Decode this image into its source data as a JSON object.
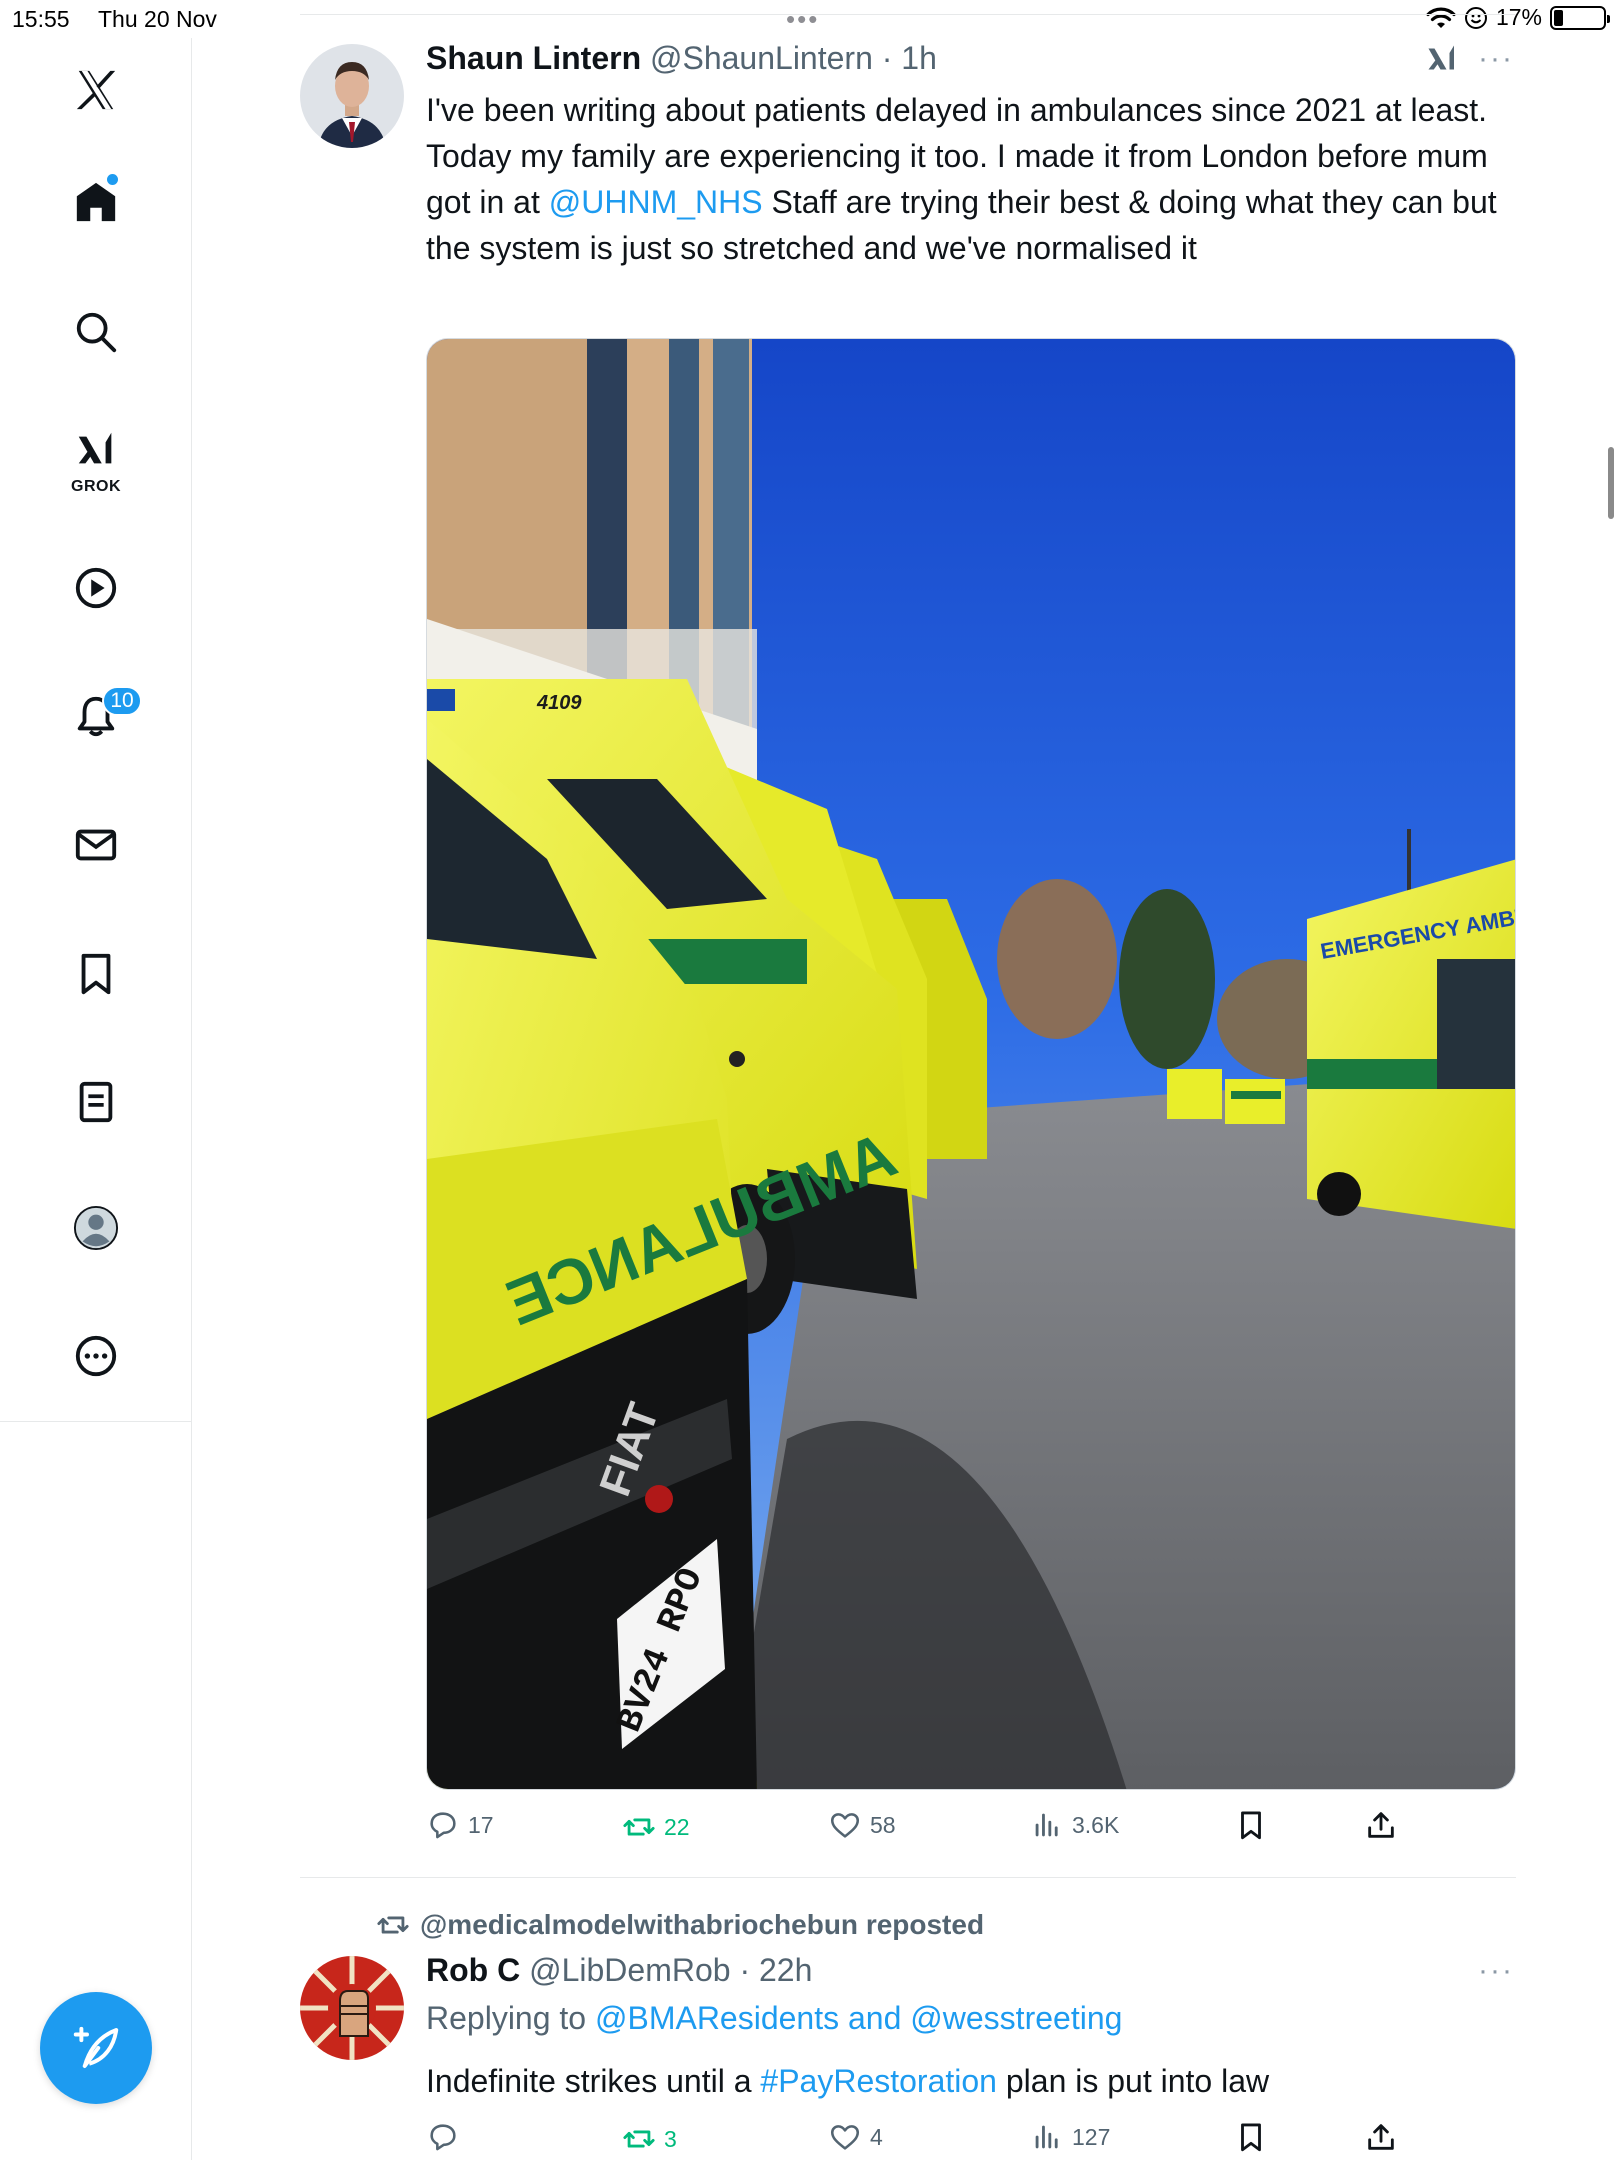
{
  "status_bar": {
    "time": "15:55",
    "date": "Thu 20 Nov",
    "battery": "17%"
  },
  "sidebar": {
    "items": [
      {
        "name": "x-logo"
      },
      {
        "name": "home"
      },
      {
        "name": "search"
      },
      {
        "name": "grok",
        "label": "GROK"
      },
      {
        "name": "video"
      },
      {
        "name": "notifications",
        "badge": "10"
      },
      {
        "name": "messages"
      },
      {
        "name": "bookmarks"
      },
      {
        "name": "lists"
      },
      {
        "name": "profile"
      },
      {
        "name": "more"
      }
    ]
  },
  "tweet1": {
    "name": "Shaun Lintern",
    "handle": "@ShaunLintern",
    "time": "1h",
    "text_before": "I've been writing about patients delayed in ambulances since 2021 at least. Today my family are experiencing it too. I made it from London before mum got in at ",
    "mention": "@UHNM_NHS",
    "text_after": "  Staff are trying their best & doing what they can but the system is just so stretched and we've normalised it",
    "photo_text": {
      "vehicle_number": "4109",
      "plate": "BV24 RPO",
      "emergency": "EMERGENCY AMBULANCE"
    },
    "stats": {
      "replies": "17",
      "reposts": "22",
      "likes": "58",
      "views": "3.6K"
    }
  },
  "tweet2": {
    "reposted_by": "@medicalmodelwithabriochebun reposted",
    "name": "Rob C",
    "handle": "@LibDemRob",
    "time": "22h",
    "replying_label": "Replying to ",
    "replying_to": "@BMAResidents and @wesstreeting",
    "text_before": "Indefinite strikes until a ",
    "hashtag": "#PayRestoration",
    "text_after": " plan is put into law",
    "stats": {
      "replies": "",
      "reposts": "3",
      "likes": "4",
      "views": "127"
    }
  },
  "colors": {
    "accent": "#1d9bf0",
    "repost_green": "#00ba7c",
    "secondary_text": "#536471"
  }
}
